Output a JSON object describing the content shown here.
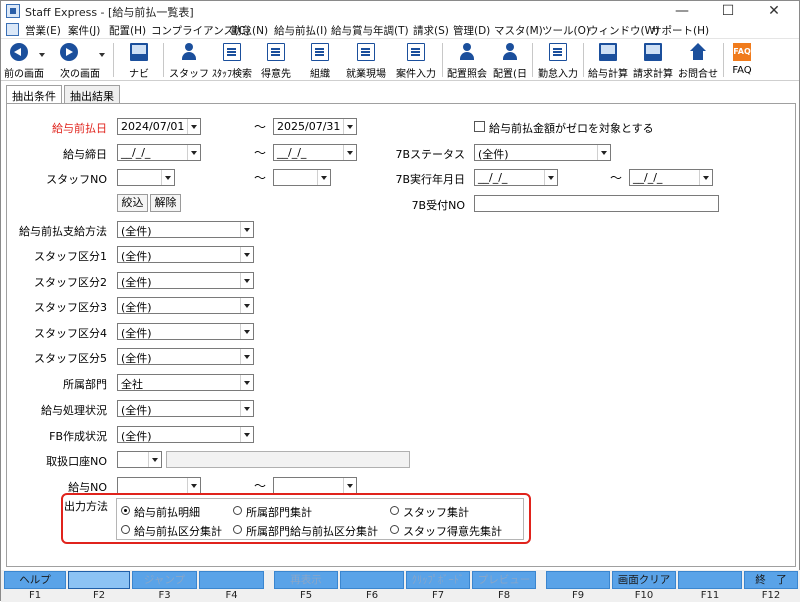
{
  "window": {
    "title": "Staff Express - [給与前払一覧表]",
    "min_glyph": "—",
    "max_glyph": "☐",
    "close_glyph": "✕"
  },
  "menu": [
    "営業(E)",
    "案件(J)",
    "配置(H)",
    "コンプライアンス(C)",
    "勤怠(N)",
    "給与前払(I)",
    "給与賞与年調(T)",
    "請求(S)",
    "管理(D)",
    "マスタ(M)",
    "ツール(O)",
    "ウィンドウ(W)",
    "サポート(H)"
  ],
  "toolbar": {
    "prev": "前の画面",
    "next": "次の画面",
    "navi": "ナビ",
    "staff": "スタッフ",
    "staff_search": "ｽﾀｯﾌ検索",
    "client": "得意先",
    "org": "組織",
    "site": "就業現場",
    "job_entry": "案件入力",
    "assign_inquiry": "配置照会",
    "assign_day": "配置(日",
    "attendance": "勤怠入力",
    "payroll": "給与計算",
    "billing": "請求計算",
    "contact": "お問合せ",
    "faq": "FAQ",
    "faq_icon_text": "FAQ"
  },
  "tabs": [
    "抽出条件",
    "抽出結果"
  ],
  "form": {
    "advance_date_label": "給与前払日",
    "advance_date_from": "2024/07/01",
    "advance_date_to": "2025/07/31",
    "tilde": "～",
    "zero_amount_label": "給与前払金額がゼロを対象とする",
    "closing_date_label": "給与締日",
    "date_placeholder": "__/_/_",
    "status_7b_label": "7Bステータス",
    "status_7b_value": "(全件)",
    "staff_no_label": "スタッフNO",
    "exec_month_7b_label": "7B実行年月日",
    "narrow_button": "絞込",
    "release_button": "解除",
    "receipt_no_7b_label": "7B受付NO",
    "payment_method_label": "給与前払支給方法",
    "payment_method_value": "(全件)",
    "staff_class1_label": "スタッフ区分1",
    "staff_class1_value": "(全件)",
    "staff_class2_label": "スタッフ区分2",
    "staff_class2_value": "(全件)",
    "staff_class3_label": "スタッフ区分3",
    "staff_class3_value": "(全件)",
    "staff_class4_label": "スタッフ区分4",
    "staff_class4_value": "(全件)",
    "staff_class5_label": "スタッフ区分5",
    "staff_class5_value": "(全件)",
    "department_label": "所属部門",
    "department_value": "全社",
    "payroll_status_label": "給与処理状況",
    "payroll_status_value": "(全件)",
    "fb_status_label": "FB作成状況",
    "fb_status_value": "(全件)",
    "bank_account_label": "取扱口座NO",
    "payroll_no_label": "給与NO",
    "output_method_label": "出力方法",
    "output_options": [
      "給与前払明細",
      "所属部門集計",
      "スタッフ集計",
      "給与前払区分集計",
      "所属部門給与前払区分集計",
      "スタッフ得意先集計"
    ],
    "output_selected_index": 0
  },
  "fkeys": [
    {
      "label": "ヘルプ",
      "num": "F1"
    },
    {
      "label": "",
      "num": "F2"
    },
    {
      "label": "ジャンプ",
      "num": "F3"
    },
    {
      "label": "",
      "num": "F4"
    },
    {
      "label": "再表示",
      "num": "F5"
    },
    {
      "label": "",
      "num": "F6"
    },
    {
      "label": "ｸﾘｯﾌﾟﾎﾞｰﾄﾞ",
      "num": "F7"
    },
    {
      "label": "プレビュー",
      "num": "F8"
    },
    {
      "label": "",
      "num": "F9"
    },
    {
      "label": "画面クリア",
      "num": "F10"
    },
    {
      "label": "",
      "num": "F11"
    },
    {
      "label": "終　了",
      "num": "F12"
    }
  ],
  "colors": {
    "accent_red": "#e0231c",
    "toolbar_blue": "#1b4f9c",
    "fkey_blue": "#5aa3e8"
  }
}
